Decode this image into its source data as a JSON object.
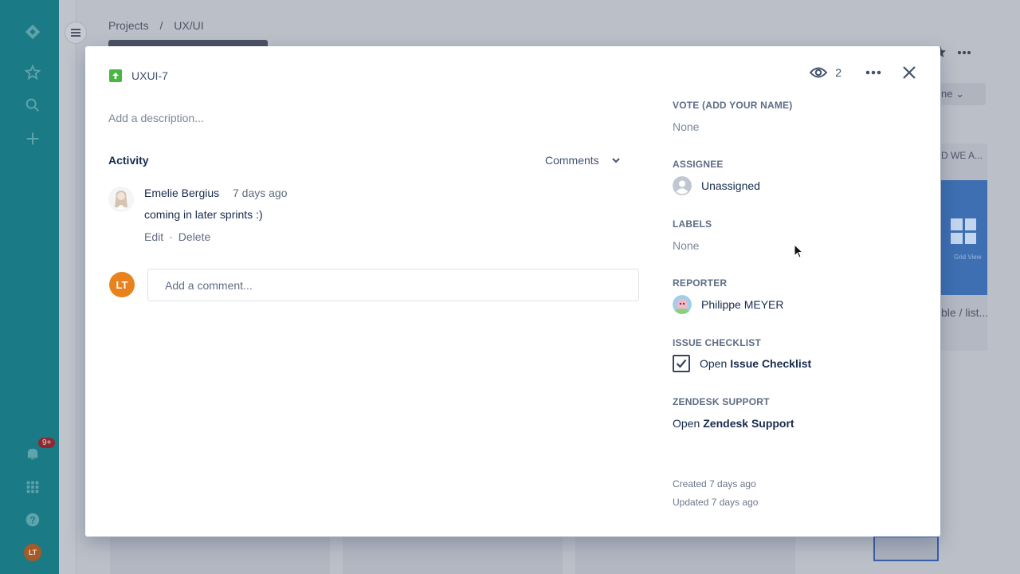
{
  "background": {
    "breadcrumb": [
      "Projects",
      "/",
      "UX/UI"
    ],
    "filter_label": "ne",
    "card_title": "D WE A...",
    "card_image_caption": "Grid View",
    "card_footer": "ble / list..."
  },
  "nav": {
    "notification_badge": "9+",
    "user_initials": "LT"
  },
  "issue": {
    "key": "UXUI-7",
    "watchers": "2",
    "description_placeholder": "Add a description..."
  },
  "activity": {
    "title": "Activity",
    "filter": "Comments",
    "comments": [
      {
        "author": "Emelie Bergius",
        "time": "7 days ago",
        "body": "coming in later sprints :)",
        "edit": "Edit",
        "separator": "·",
        "delete": "Delete"
      }
    ],
    "new_comment_initials": "LT",
    "new_comment_placeholder": "Add a comment..."
  },
  "fields": {
    "vote_label": "VOTE (ADD YOUR NAME)",
    "vote_value": "None",
    "assignee_label": "ASSIGNEE",
    "assignee_value": "Unassigned",
    "labels_label": "LABELS",
    "labels_value": "None",
    "reporter_label": "REPORTER",
    "reporter_value": "Philippe MEYER",
    "checklist_label": "ISSUE CHECKLIST",
    "checklist_prefix": "Open",
    "checklist_name": "Issue Checklist",
    "zendesk_label": "ZENDESK SUPPORT",
    "zendesk_prefix": "Open",
    "zendesk_name": "Zendesk Support",
    "created": "Created 7 days ago",
    "updated": "Updated 7 days ago"
  },
  "colors": {
    "nav_bg": "#1a7a86",
    "story_icon": "#4bb543",
    "avatar_lt": "#e8821d"
  }
}
